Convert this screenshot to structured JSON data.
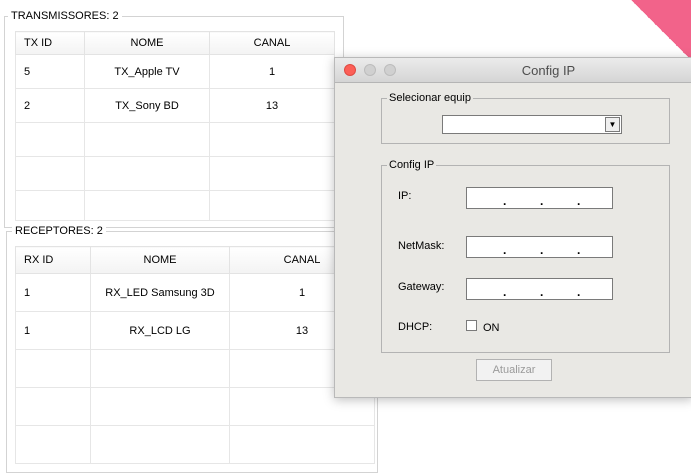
{
  "transmitters": {
    "title": "TRANSMISSORES: 2",
    "columns": [
      "TX ID",
      "NOME",
      "CANAL"
    ],
    "rows": [
      {
        "id": "5",
        "name": "TX_Apple TV",
        "channel": "1"
      },
      {
        "id": "2",
        "name": "TX_Sony BD",
        "channel": "13"
      }
    ]
  },
  "receivers": {
    "title": "RECEPTORES: 2",
    "columns": [
      "RX ID",
      "NOME",
      "CANAL"
    ],
    "rows": [
      {
        "id": "1",
        "name": "RX_LED Samsung 3D",
        "channel": "1"
      },
      {
        "id": "1",
        "name": "RX_LCD LG",
        "channel": "13"
      }
    ]
  },
  "dialog": {
    "title": "Config IP",
    "select_group": "Selecionar equip",
    "select_value": "",
    "config_group": "Config IP",
    "ip_label": "IP:",
    "netmask_label": "NetMask:",
    "gateway_label": "Gateway:",
    "dhcp_label": "DHCP:",
    "dhcp_option": "ON",
    "ip_dots": ".",
    "update_button": "Atualizar"
  },
  "colors": {
    "close": "#fc5f57",
    "minimize": "#d0d0d0",
    "zoom": "#d0d0d0",
    "ribbon": "#f2638a"
  }
}
